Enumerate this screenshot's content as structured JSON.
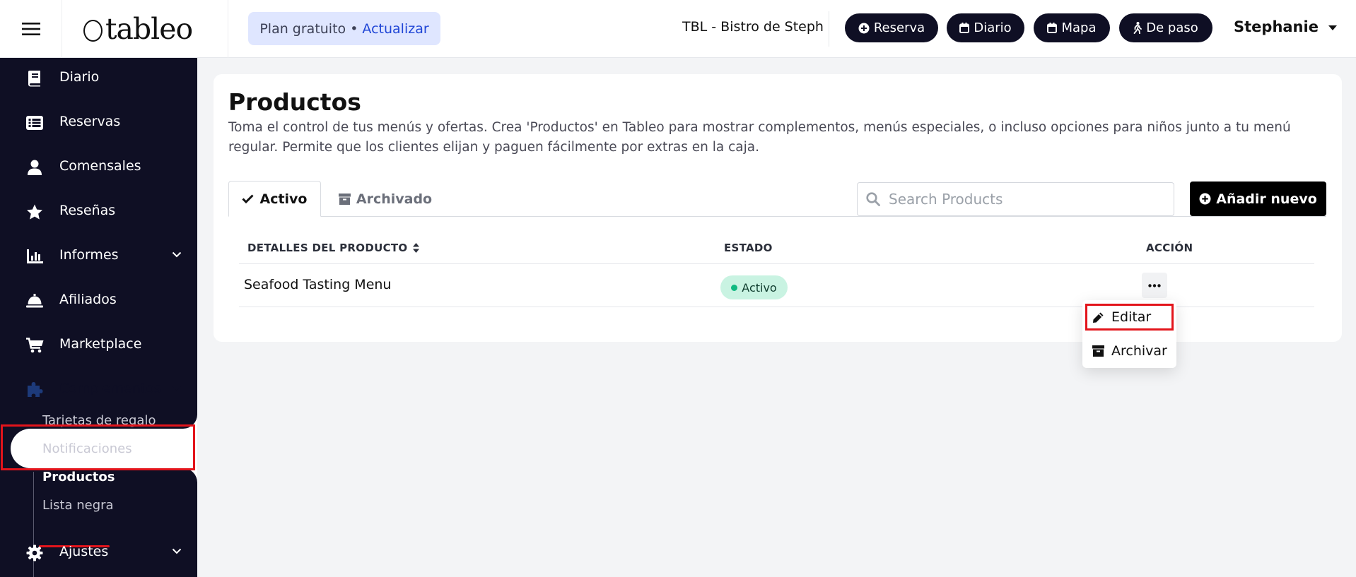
{
  "header": {
    "logo_text": "tableo",
    "plan_label": "Plan gratuito •",
    "plan_upgrade": "Actualizar",
    "venue_name": "TBL - Bistro de Steph",
    "quick_actions": [
      {
        "label": "Reserva",
        "icon": "plus-circle-icon"
      },
      {
        "label": "Diario",
        "icon": "calendar-icon"
      },
      {
        "label": "Mapa",
        "icon": "calendar-icon"
      },
      {
        "label": "De paso",
        "icon": "walking-icon"
      }
    ],
    "user_name": "Stephanie"
  },
  "sidebar": {
    "items": [
      {
        "label": "Diario",
        "icon": "book-icon"
      },
      {
        "label": "Reservas",
        "icon": "list-icon"
      },
      {
        "label": "Comensales",
        "icon": "user-icon"
      },
      {
        "label": "Reseñas",
        "icon": "star-icon"
      },
      {
        "label": "Informes",
        "icon": "bar-chart-icon"
      },
      {
        "label": "Afiliados",
        "icon": "bell-icon"
      },
      {
        "label": "Marketplace",
        "icon": "cart-icon"
      },
      {
        "label": "Complementos",
        "icon": "puzzle-icon"
      },
      {
        "label": "Ajustes",
        "icon": "gear-icon"
      }
    ],
    "active_item": "Complementos",
    "subitems": [
      {
        "label": "Tarjetas de regalo"
      },
      {
        "label": "Notificaciones"
      },
      {
        "label": "Productos"
      },
      {
        "label": "Lista negra"
      }
    ],
    "current_subitem": "Productos"
  },
  "main": {
    "title": "Productos",
    "description": "Toma el control de tus menús y ofertas. Crea 'Productos' en Tableo para mostrar complementos, menús especiales, o incluso opciones para niños junto a tu menú regular. Permite que los clientes elijan y paguen fácilmente por extras en la caja.",
    "tabs": [
      {
        "label": "Activo",
        "icon": "check-icon"
      },
      {
        "label": "Archivado",
        "icon": "archive-icon"
      }
    ],
    "active_tab": "Activo",
    "search": {
      "placeholder": "Search Products",
      "value": ""
    },
    "add_button": "Añadir nuevo",
    "table": {
      "columns": [
        "DETALLES DEL PRODUCTO",
        "ESTADO",
        "ACCIÓN"
      ],
      "rows": [
        {
          "name": "Seafood Tasting Menu",
          "status": "Activo"
        }
      ]
    },
    "row_menu": {
      "items": [
        {
          "label": "Editar",
          "icon": "pencil-icon"
        },
        {
          "label": "Archivar",
          "icon": "archive-icon"
        }
      ]
    }
  },
  "colors": {
    "sidebar_bg": "#0f0f24",
    "accent_blue": "#2046d6",
    "plan_bg": "#dfe6ff",
    "status_bg": "#c9f3e2",
    "status_dot": "#10b981",
    "highlight_red": "#e3141b"
  }
}
